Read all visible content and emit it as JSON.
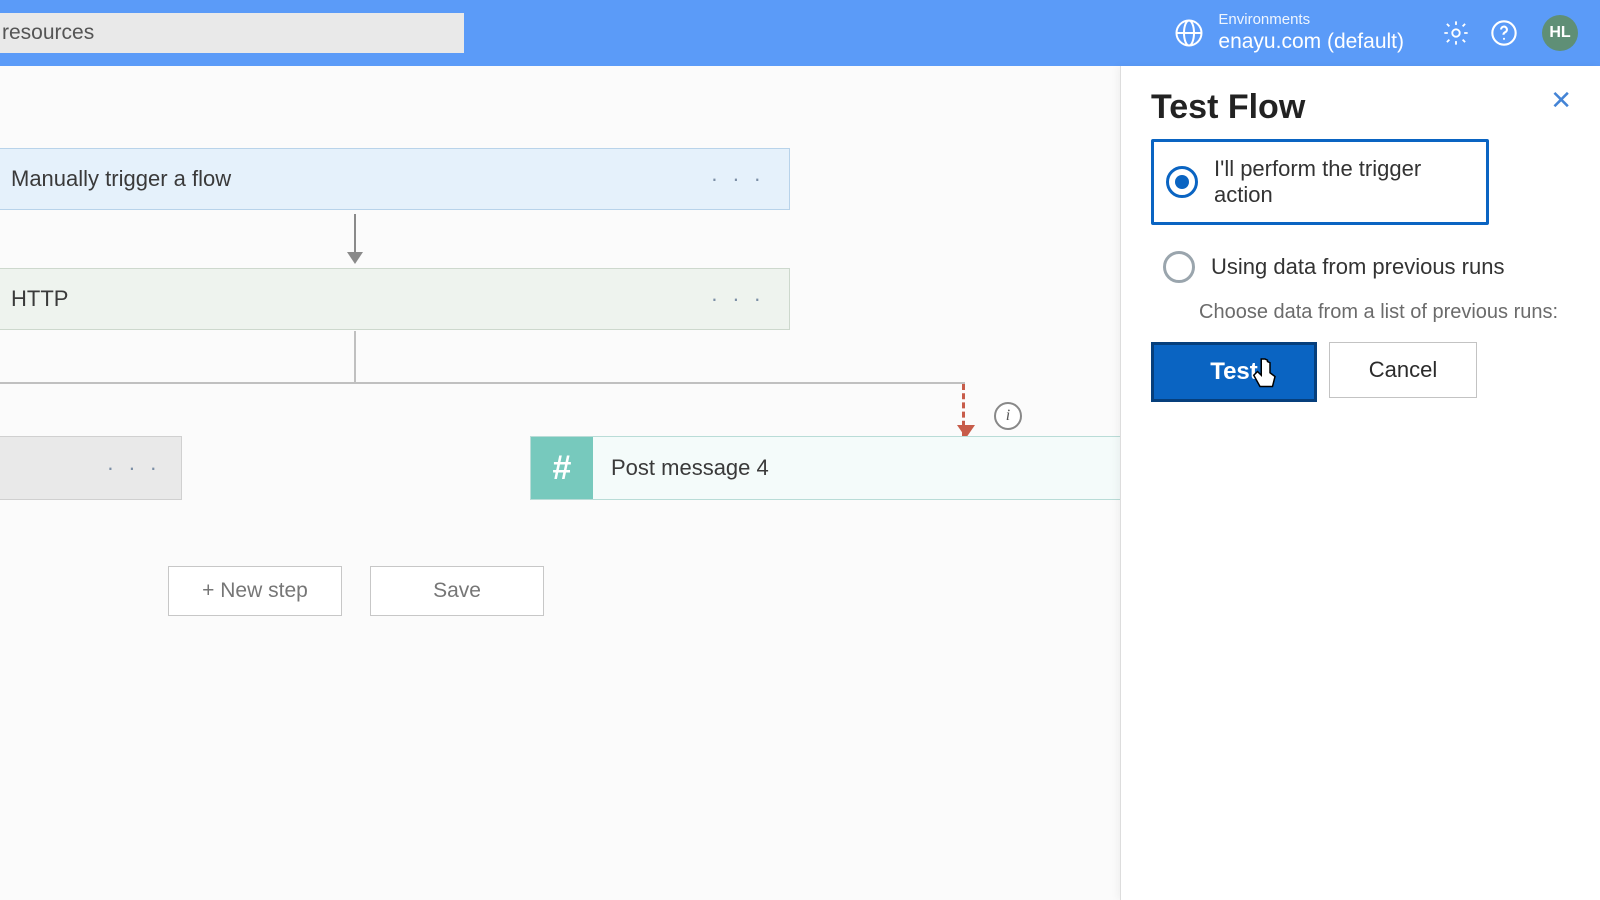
{
  "topbar": {
    "search_value": "resources",
    "env_label": "Environments",
    "env_name": "enayu.com (default)",
    "avatar": "HL"
  },
  "flow": {
    "trigger_label": "Manually trigger a flow",
    "http_label": "HTTP",
    "post_label": "Post message 4",
    "new_step": "+ New step",
    "save": "Save"
  },
  "panel": {
    "title": "Test Flow",
    "opt_manual": "I'll perform the trigger action",
    "opt_previous": "Using data from previous runs",
    "hint": "Choose data from a list of previous runs:",
    "test_btn": "Test",
    "cancel_btn": "Cancel"
  }
}
